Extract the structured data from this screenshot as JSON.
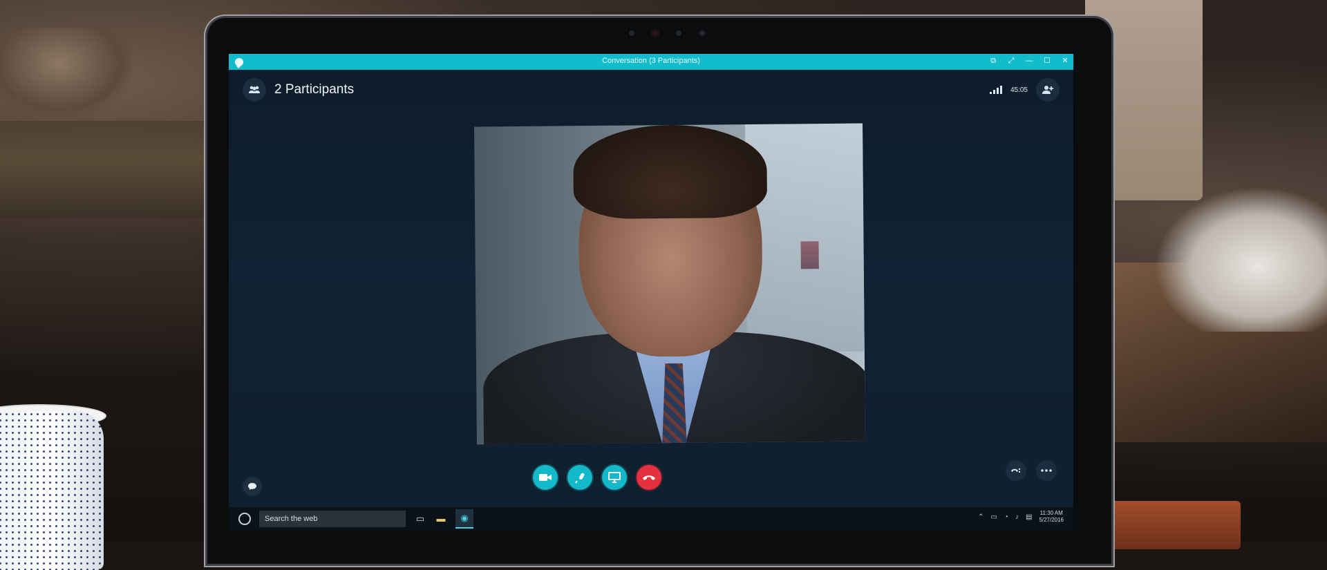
{
  "window": {
    "title": "Conversation (3 Participants)",
    "accent_color": "#12bccb",
    "controls": [
      {
        "icon": "compact-view-icon",
        "glyph": "⧉"
      },
      {
        "icon": "fullscreen-icon",
        "glyph": "⤢"
      },
      {
        "icon": "minimize-icon",
        "glyph": "—"
      },
      {
        "icon": "maximize-icon",
        "glyph": "☐"
      },
      {
        "icon": "close-icon",
        "glyph": "✕"
      }
    ]
  },
  "header": {
    "participants_label": "2 Participants",
    "call_timer": "45:05",
    "participants_icon": "participants-icon",
    "add_participant_icon": "add-person-icon"
  },
  "call_controls": [
    {
      "name": "video-toggle-button",
      "icon": "video-camera-icon",
      "glyph": "▶"
    },
    {
      "name": "microphone-button",
      "icon": "microphone-icon",
      "glyph": "🎤"
    },
    {
      "name": "share-screen-button",
      "icon": "monitor-icon",
      "glyph": "🖵"
    },
    {
      "name": "end-call-button",
      "icon": "hang-up-icon",
      "glyph": "☎",
      "color": "#e5313f"
    }
  ],
  "side_buttons": {
    "chat_icon": "chat-icon",
    "dialpad_icon": "dialpad-icon",
    "more_icon": "more-options-icon"
  },
  "taskbar": {
    "search_placeholder": "Search the web",
    "clock_time": "11:30 AM",
    "clock_date": "5/27/2016"
  }
}
